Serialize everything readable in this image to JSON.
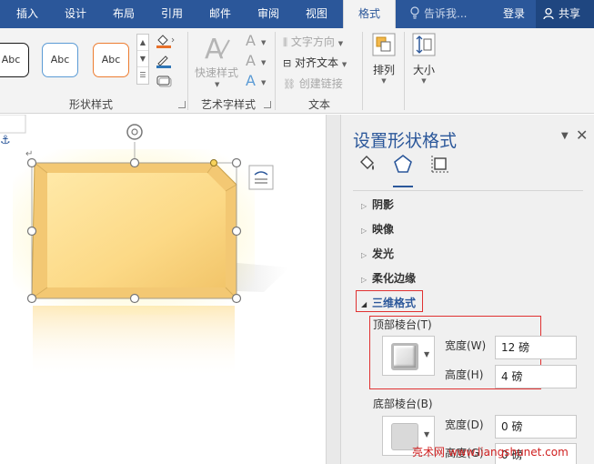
{
  "tabs": [
    {
      "label": "插入",
      "active": false
    },
    {
      "label": "设计",
      "active": false
    },
    {
      "label": "布局",
      "active": false
    },
    {
      "label": "引用",
      "active": false
    },
    {
      "label": "邮件",
      "active": false
    },
    {
      "label": "审阅",
      "active": false
    },
    {
      "label": "视图",
      "active": false
    },
    {
      "label": "格式",
      "active": true
    }
  ],
  "tell_me": "告诉我...",
  "login": "登录",
  "share": "共享",
  "ribbon": {
    "shape_styles": {
      "label": "形状样式",
      "buttons": [
        {
          "text": "Abc",
          "border_color": "#1a1a1a"
        },
        {
          "text": "Abc",
          "border_color": "#5b9bd5"
        },
        {
          "text": "Abc",
          "border_color": "#ed7d31"
        }
      ],
      "fill_color": "#e8702a",
      "outline_color": "#2e75b6"
    },
    "wordart": {
      "label": "艺术字样式",
      "quick_styles": "快速样式"
    },
    "text": {
      "label": "文本",
      "direction": "文字方向",
      "align": "对齐文本",
      "link": "创建链接"
    },
    "arrange": "排列",
    "size": "大小"
  },
  "pane": {
    "title": "设置形状格式",
    "sections": [
      {
        "label": "阴影",
        "expanded": false
      },
      {
        "label": "映像",
        "expanded": false
      },
      {
        "label": "发光",
        "expanded": false
      },
      {
        "label": "柔化边缘",
        "expanded": false
      },
      {
        "label": "三维格式",
        "expanded": true
      }
    ],
    "top_bevel": {
      "label": "顶部棱台(T)",
      "width_label": "宽度(W)",
      "width_value": "12 磅",
      "height_label": "高度(H)",
      "height_value": "4 磅"
    },
    "bottom_bevel": {
      "label": "底部棱台(B)",
      "width_label": "宽度(D)",
      "width_value": "0 磅",
      "height_label": "高度(G)",
      "height_value": "0 磅"
    }
  },
  "watermark": "亮术网 www.liangshunet.com"
}
